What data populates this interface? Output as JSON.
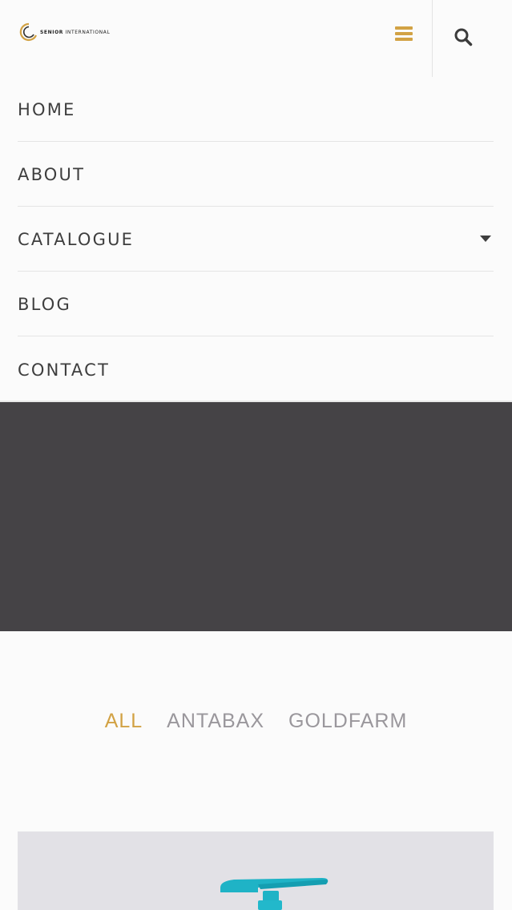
{
  "header": {
    "logo_brand": "SENIOR",
    "logo_suffix": "INTERNATIONAL",
    "menu_icon": "hamburger-icon",
    "search_icon": "search-icon",
    "accent_color": "#d2a244"
  },
  "nav": {
    "items": [
      {
        "label": "HOME"
      },
      {
        "label": "ABOUT"
      },
      {
        "label": "CATALOGUE",
        "has_dropdown": true
      },
      {
        "label": "BLOG"
      },
      {
        "label": "CONTACT"
      }
    ]
  },
  "hero": {
    "background_color": "#454346"
  },
  "filters": {
    "items": [
      {
        "label": "ALL",
        "active": true
      },
      {
        "label": "ANTABAX",
        "active": false
      },
      {
        "label": "GOLDFARM",
        "active": false
      }
    ]
  },
  "product": {
    "image": "pump-bottle-teal"
  }
}
